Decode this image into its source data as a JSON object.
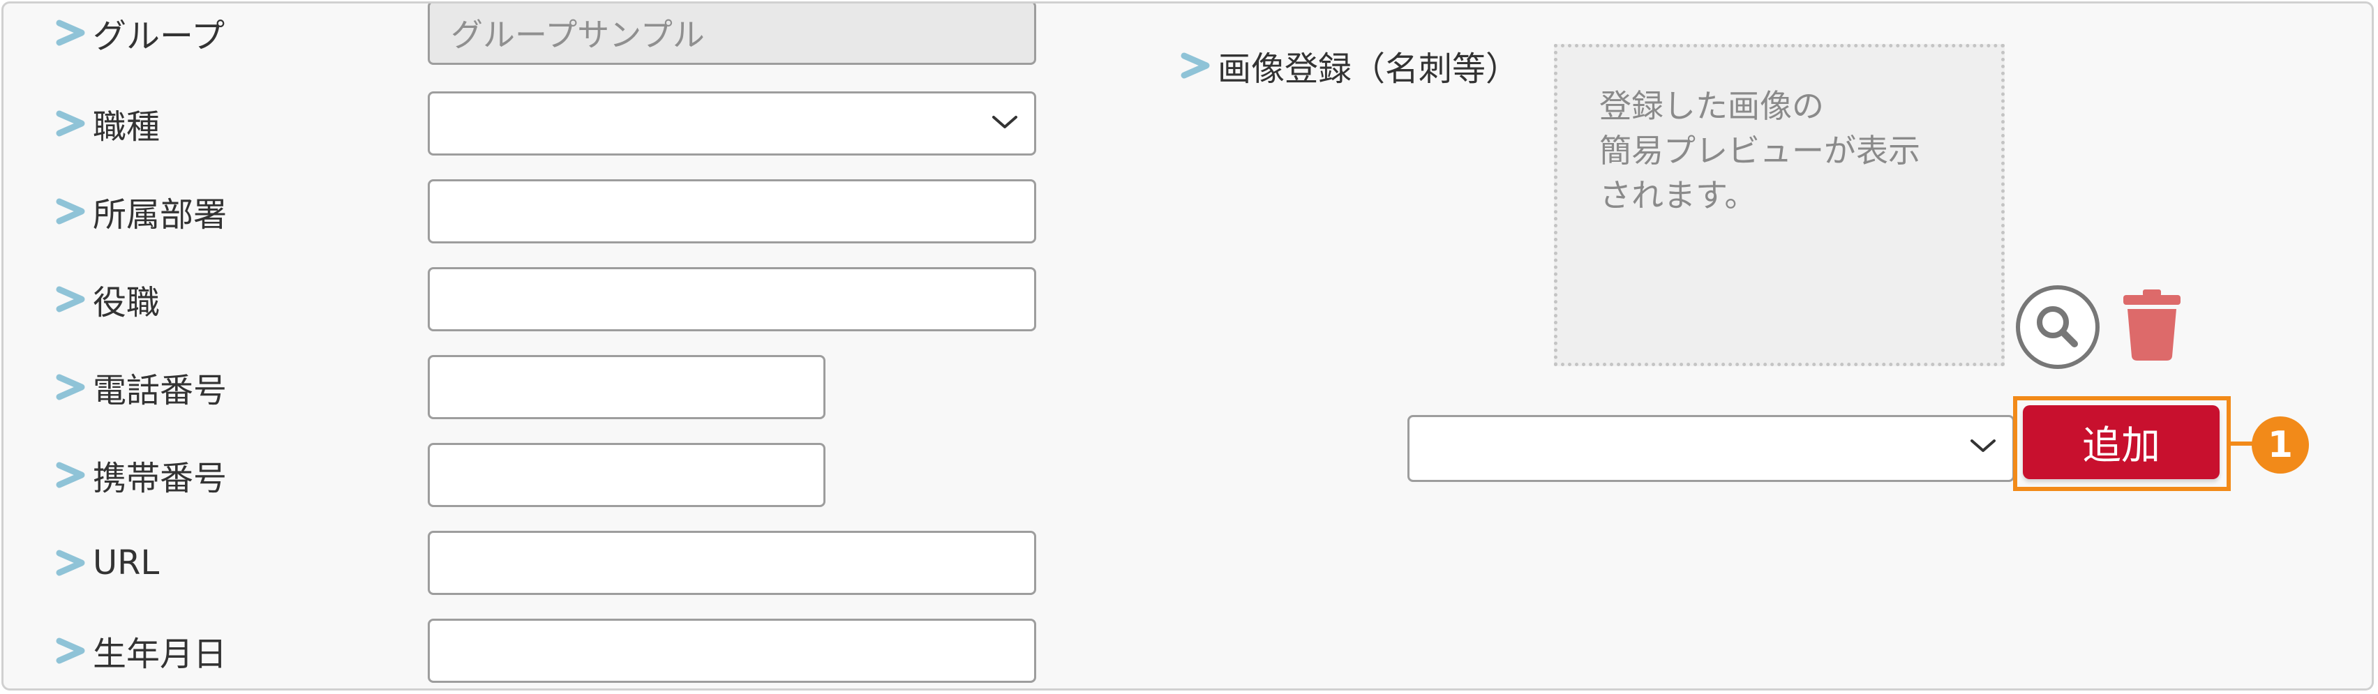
{
  "form": {
    "rows": [
      {
        "label": "グループ",
        "value": "グループサンプル"
      },
      {
        "label": "職種",
        "value": ""
      },
      {
        "label": "所属部署",
        "value": ""
      },
      {
        "label": "役職",
        "value": ""
      },
      {
        "label": "電話番号",
        "value": ""
      },
      {
        "label": "携帯番号",
        "value": ""
      },
      {
        "label": "URL",
        "value": ""
      },
      {
        "label": "生年月日",
        "value": ""
      }
    ]
  },
  "image_section": {
    "label": "画像登録（名刺等）",
    "preview_lines": [
      "登録した画像の",
      "簡易プレビューが表示",
      "されます。"
    ],
    "zoom_icon": "magnifier-icon",
    "delete_icon": "trash-icon",
    "select_value": "",
    "add_label": "追加",
    "callout_number": "1"
  },
  "colors": {
    "accent_chevron": "#8fc3d7",
    "add_button": "#c8102e",
    "highlight": "#f28a19",
    "trash": "#dd6a6a",
    "zoom": "#777777"
  }
}
